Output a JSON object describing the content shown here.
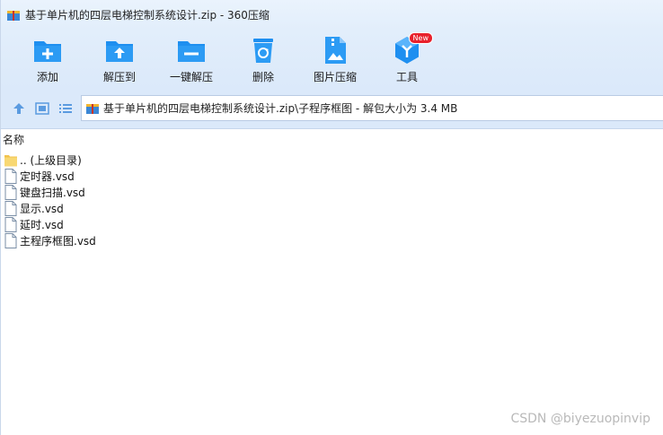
{
  "window": {
    "title": "基于单片机的四层电梯控制系统设计.zip - 360压缩"
  },
  "toolbar": {
    "items": [
      {
        "label": "添加",
        "icon": "add-folder-icon"
      },
      {
        "label": "解压到",
        "icon": "extract-to-icon"
      },
      {
        "label": "一键解压",
        "icon": "one-click-extract-icon"
      },
      {
        "label": "删除",
        "icon": "recycle-bin-icon"
      },
      {
        "label": "图片压缩",
        "icon": "image-compress-icon"
      },
      {
        "label": "工具",
        "icon": "tools-cube-icon",
        "badge": "New"
      }
    ]
  },
  "address": {
    "path": "基于单片机的四层电梯控制系统设计.zip\\子程序框图 - 解包大小为 3.4 MB"
  },
  "list": {
    "header_name": "名称",
    "files": [
      {
        "name": ".. (上级目录)",
        "type": "folder"
      },
      {
        "name": "定时器.vsd",
        "type": "file"
      },
      {
        "name": "键盘扫描.vsd",
        "type": "file"
      },
      {
        "name": "显示.vsd",
        "type": "file"
      },
      {
        "name": "延时.vsd",
        "type": "file"
      },
      {
        "name": "主程序框图.vsd",
        "type": "file"
      }
    ]
  },
  "watermark": "CSDN @biyezuopinvip",
  "colors": {
    "toolbar_bg": "#dbe9fa",
    "icon_blue": "#1e8ff0",
    "badge_red": "#e8212c"
  }
}
